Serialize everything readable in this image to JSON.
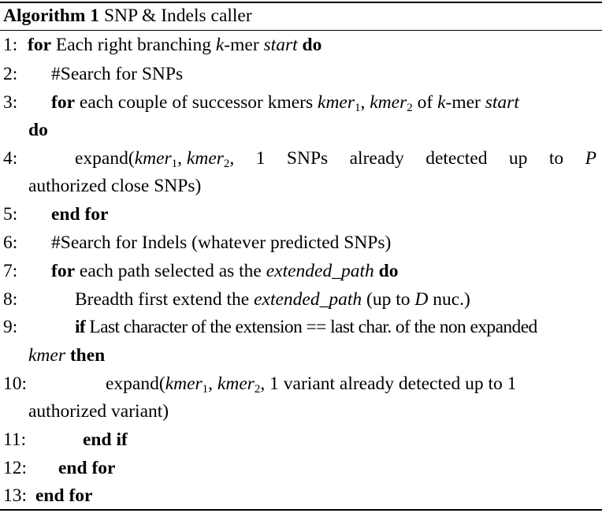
{
  "algorithm": {
    "label": "Algorithm 1",
    "title": "SNP & Indels caller"
  },
  "lines": {
    "l1": {
      "num": "1:",
      "kw_for": "for",
      "t1": " Each right branching ",
      "k": "k",
      "t2": "-mer ",
      "start": "start",
      "kw_do": " do"
    },
    "l2": {
      "num": "2:",
      "text": "#Search for SNPs"
    },
    "l3": {
      "num": "3:",
      "kw_for": "for",
      "t1": " each couple of successor kmers ",
      "kmer": "kmer",
      "sub1": "1",
      "comma": ", ",
      "kmer2": "kmer",
      "sub2": "2",
      "t2": " of ",
      "k": "k",
      "t3": "-mer ",
      "start": "start",
      "kw_do": "do"
    },
    "l4": {
      "num": "4:",
      "t1": "expand(",
      "kmer": "kmer",
      "sub1": "1",
      "comma": ", ",
      "kmer2": "kmer",
      "sub2": "2",
      "t2": ",",
      "w1": "1",
      "w2": "SNPs",
      "w3": "already",
      "w4": "detected",
      "w5": "up",
      "w6": "to",
      "P": "P",
      "t3": "authorized close SNPs)"
    },
    "l5": {
      "num": "5:",
      "kw": "end for"
    },
    "l6": {
      "num": "6:",
      "text": "#Search for Indels (whatever predicted SNPs)"
    },
    "l7": {
      "num": "7:",
      "kw_for": "for",
      "t1": " each path selected as the ",
      "ep": "extended_path",
      "kw_do": " do"
    },
    "l8": {
      "num": "8:",
      "t1": "Breadth first extend the ",
      "ep": "extended_path",
      "t2": " (up to ",
      "D": "D",
      "t3": " nuc.)"
    },
    "l9": {
      "num": "9:",
      "kw_if": "if",
      "t1": " Last character of the extension == last char. of the non expanded",
      "kmer": "kmer",
      "kw_then": " then"
    },
    "l10": {
      "num": "10:",
      "t1": "expand(",
      "kmer": "kmer",
      "sub1": "1",
      "comma": ", ",
      "kmer2": "kmer",
      "sub2": "2",
      "t2": ", 1 variant already detected up to 1",
      "t3": "authorized variant)"
    },
    "l11": {
      "num": "11:",
      "kw": "end if"
    },
    "l12": {
      "num": "12:",
      "kw": "end for"
    },
    "l13": {
      "num": "13:",
      "kw": "end for"
    }
  }
}
